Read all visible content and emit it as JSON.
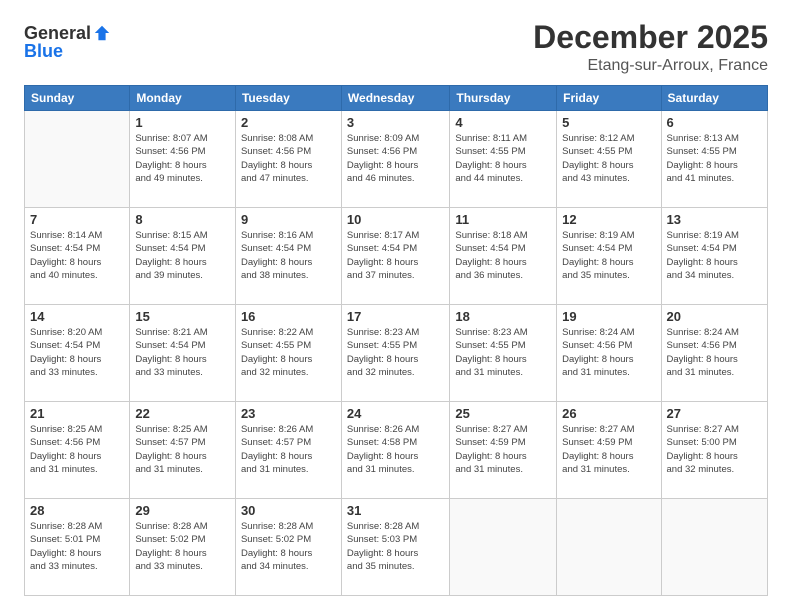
{
  "logo": {
    "general": "General",
    "blue": "Blue"
  },
  "header": {
    "month": "December 2025",
    "location": "Etang-sur-Arroux, France"
  },
  "days_of_week": [
    "Sunday",
    "Monday",
    "Tuesday",
    "Wednesday",
    "Thursday",
    "Friday",
    "Saturday"
  ],
  "weeks": [
    [
      {
        "day": "",
        "info": ""
      },
      {
        "day": "1",
        "info": "Sunrise: 8:07 AM\nSunset: 4:56 PM\nDaylight: 8 hours\nand 49 minutes."
      },
      {
        "day": "2",
        "info": "Sunrise: 8:08 AM\nSunset: 4:56 PM\nDaylight: 8 hours\nand 47 minutes."
      },
      {
        "day": "3",
        "info": "Sunrise: 8:09 AM\nSunset: 4:56 PM\nDaylight: 8 hours\nand 46 minutes."
      },
      {
        "day": "4",
        "info": "Sunrise: 8:11 AM\nSunset: 4:55 PM\nDaylight: 8 hours\nand 44 minutes."
      },
      {
        "day": "5",
        "info": "Sunrise: 8:12 AM\nSunset: 4:55 PM\nDaylight: 8 hours\nand 43 minutes."
      },
      {
        "day": "6",
        "info": "Sunrise: 8:13 AM\nSunset: 4:55 PM\nDaylight: 8 hours\nand 41 minutes."
      }
    ],
    [
      {
        "day": "7",
        "info": "Sunrise: 8:14 AM\nSunset: 4:54 PM\nDaylight: 8 hours\nand 40 minutes."
      },
      {
        "day": "8",
        "info": "Sunrise: 8:15 AM\nSunset: 4:54 PM\nDaylight: 8 hours\nand 39 minutes."
      },
      {
        "day": "9",
        "info": "Sunrise: 8:16 AM\nSunset: 4:54 PM\nDaylight: 8 hours\nand 38 minutes."
      },
      {
        "day": "10",
        "info": "Sunrise: 8:17 AM\nSunset: 4:54 PM\nDaylight: 8 hours\nand 37 minutes."
      },
      {
        "day": "11",
        "info": "Sunrise: 8:18 AM\nSunset: 4:54 PM\nDaylight: 8 hours\nand 36 minutes."
      },
      {
        "day": "12",
        "info": "Sunrise: 8:19 AM\nSunset: 4:54 PM\nDaylight: 8 hours\nand 35 minutes."
      },
      {
        "day": "13",
        "info": "Sunrise: 8:19 AM\nSunset: 4:54 PM\nDaylight: 8 hours\nand 34 minutes."
      }
    ],
    [
      {
        "day": "14",
        "info": "Sunrise: 8:20 AM\nSunset: 4:54 PM\nDaylight: 8 hours\nand 33 minutes."
      },
      {
        "day": "15",
        "info": "Sunrise: 8:21 AM\nSunset: 4:54 PM\nDaylight: 8 hours\nand 33 minutes."
      },
      {
        "day": "16",
        "info": "Sunrise: 8:22 AM\nSunset: 4:55 PM\nDaylight: 8 hours\nand 32 minutes."
      },
      {
        "day": "17",
        "info": "Sunrise: 8:23 AM\nSunset: 4:55 PM\nDaylight: 8 hours\nand 32 minutes."
      },
      {
        "day": "18",
        "info": "Sunrise: 8:23 AM\nSunset: 4:55 PM\nDaylight: 8 hours\nand 31 minutes."
      },
      {
        "day": "19",
        "info": "Sunrise: 8:24 AM\nSunset: 4:56 PM\nDaylight: 8 hours\nand 31 minutes."
      },
      {
        "day": "20",
        "info": "Sunrise: 8:24 AM\nSunset: 4:56 PM\nDaylight: 8 hours\nand 31 minutes."
      }
    ],
    [
      {
        "day": "21",
        "info": "Sunrise: 8:25 AM\nSunset: 4:56 PM\nDaylight: 8 hours\nand 31 minutes."
      },
      {
        "day": "22",
        "info": "Sunrise: 8:25 AM\nSunset: 4:57 PM\nDaylight: 8 hours\nand 31 minutes."
      },
      {
        "day": "23",
        "info": "Sunrise: 8:26 AM\nSunset: 4:57 PM\nDaylight: 8 hours\nand 31 minutes."
      },
      {
        "day": "24",
        "info": "Sunrise: 8:26 AM\nSunset: 4:58 PM\nDaylight: 8 hours\nand 31 minutes."
      },
      {
        "day": "25",
        "info": "Sunrise: 8:27 AM\nSunset: 4:59 PM\nDaylight: 8 hours\nand 31 minutes."
      },
      {
        "day": "26",
        "info": "Sunrise: 8:27 AM\nSunset: 4:59 PM\nDaylight: 8 hours\nand 31 minutes."
      },
      {
        "day": "27",
        "info": "Sunrise: 8:27 AM\nSunset: 5:00 PM\nDaylight: 8 hours\nand 32 minutes."
      }
    ],
    [
      {
        "day": "28",
        "info": "Sunrise: 8:28 AM\nSunset: 5:01 PM\nDaylight: 8 hours\nand 33 minutes."
      },
      {
        "day": "29",
        "info": "Sunrise: 8:28 AM\nSunset: 5:02 PM\nDaylight: 8 hours\nand 33 minutes."
      },
      {
        "day": "30",
        "info": "Sunrise: 8:28 AM\nSunset: 5:02 PM\nDaylight: 8 hours\nand 34 minutes."
      },
      {
        "day": "31",
        "info": "Sunrise: 8:28 AM\nSunset: 5:03 PM\nDaylight: 8 hours\nand 35 minutes."
      },
      {
        "day": "",
        "info": ""
      },
      {
        "day": "",
        "info": ""
      },
      {
        "day": "",
        "info": ""
      }
    ]
  ]
}
